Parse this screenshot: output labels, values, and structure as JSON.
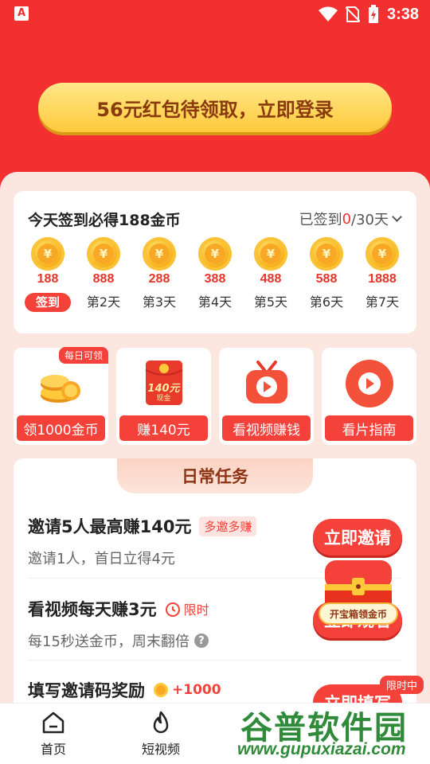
{
  "status": {
    "time": "3:38"
  },
  "banner": {
    "login_label": "56元红包待领取，立即登录"
  },
  "signin": {
    "title": "今天签到必得188金币",
    "status_prefix": "已签到",
    "status_count": "0",
    "status_suffix": "/30天",
    "days": [
      {
        "amount": "188",
        "label": "签到",
        "active": true
      },
      {
        "amount": "888",
        "label": "第2天"
      },
      {
        "amount": "288",
        "label": "第3天"
      },
      {
        "amount": "388",
        "label": "第4天"
      },
      {
        "amount": "488",
        "label": "第5天"
      },
      {
        "amount": "588",
        "label": "第6天"
      },
      {
        "amount": "1888",
        "label": "第7天"
      }
    ]
  },
  "tiles": [
    {
      "label": "领1000金币",
      "badge": "每日可领",
      "icon": "coin-stack-icon"
    },
    {
      "label": "赚140元",
      "icon": "red-envelope-icon",
      "envelope_amount": "140元",
      "envelope_sub": "现金"
    },
    {
      "label": "看视频赚钱",
      "icon": "tv-play-icon"
    },
    {
      "label": "看片指南",
      "icon": "play-circle-icon"
    }
  ],
  "tasks": {
    "header": "日常任务",
    "items": [
      {
        "title": "邀请5人最高赚140元",
        "tag": "多邀多赚",
        "desc": "邀请1人，首日立得4元",
        "button": "立即邀请"
      },
      {
        "title": "看视频每天赚3元",
        "tag": "限时",
        "desc": "每15秒送金币，周末翻倍",
        "button": "立即观看"
      },
      {
        "title": "填写邀请码奖励",
        "tag": "+1000",
        "button": "立即填写",
        "badge": "限时中"
      }
    ]
  },
  "chest": {
    "label": "开宝箱领金币"
  },
  "nav": [
    {
      "label": "首页",
      "icon": "home-icon"
    },
    {
      "label": "短视频",
      "icon": "flame-icon"
    }
  ],
  "watermark": {
    "main": "谷普软件园",
    "url": "www.gupuxiazai.com"
  },
  "colors": {
    "primary": "#f23030",
    "accent": "#f4413a",
    "gold": "#ffc93a",
    "panel_bg": "#fbe6e0"
  }
}
